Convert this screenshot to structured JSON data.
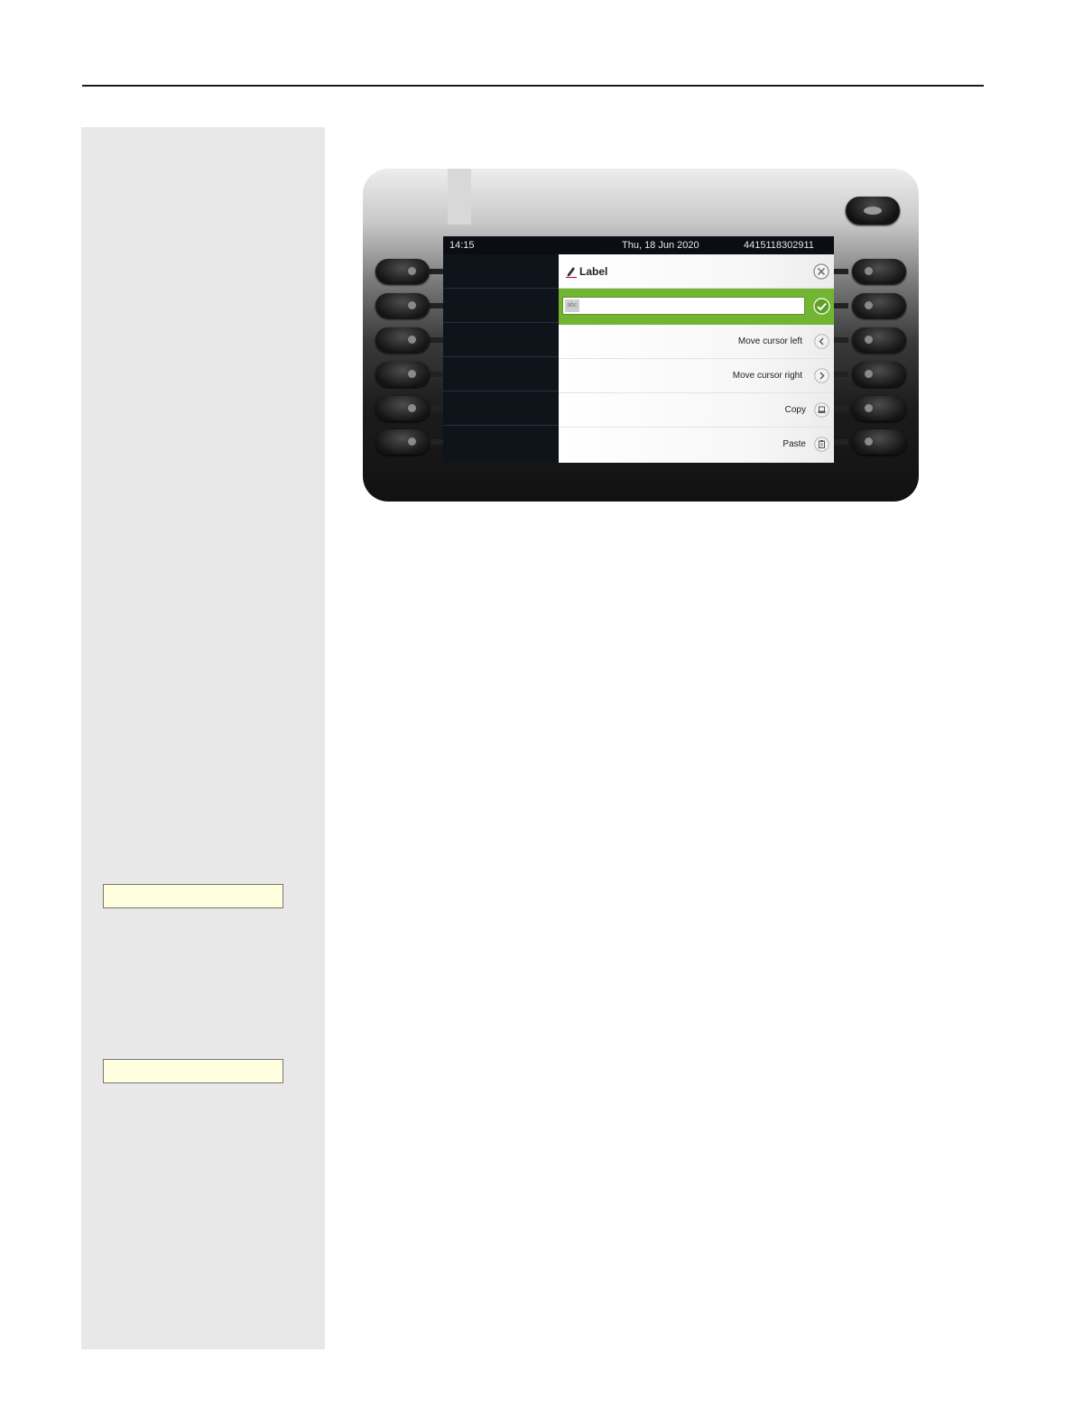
{
  "status_bar": {
    "time": "14:15",
    "date": "Thu, 18 Jun 2020",
    "number": "4415118302911"
  },
  "dialog": {
    "title": "Label",
    "input_value": "",
    "input_mode_label": "abc",
    "options": [
      {
        "label": "Move cursor left",
        "icon": "chevron-left-icon"
      },
      {
        "label": "Move cursor right",
        "icon": "chevron-right-icon"
      },
      {
        "label": "Copy",
        "icon": "copy-icon"
      },
      {
        "label": "Paste",
        "icon": "paste-icon"
      }
    ]
  },
  "colors": {
    "accent_green": "#72b532",
    "screen_dark": "#0c1016",
    "sidebar_gray": "#e8e8e8",
    "note_yellow": "#ffffe0"
  }
}
